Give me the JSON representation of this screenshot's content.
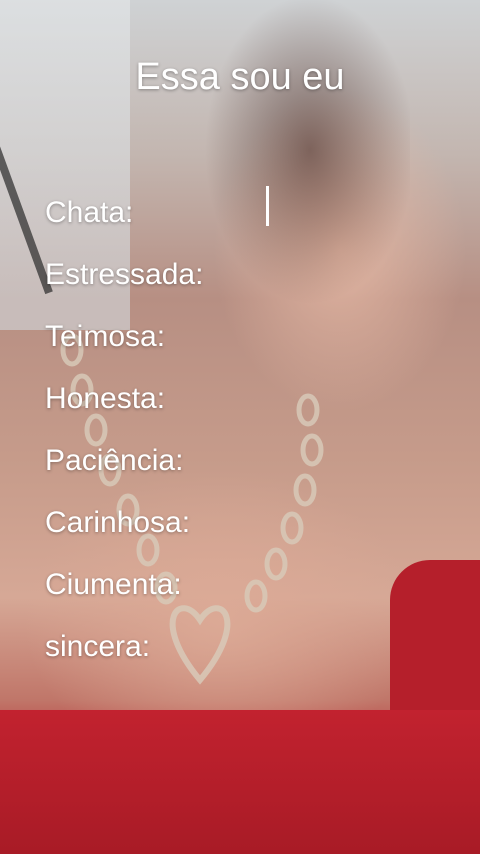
{
  "title": "Essa sou eu",
  "traits": [
    {
      "label": "Chata:"
    },
    {
      "label": "Estressada:"
    },
    {
      "label": "Teimosa:"
    },
    {
      "label": "Honesta:"
    },
    {
      "label": "Paciência:"
    },
    {
      "label": "Carinhosa:"
    },
    {
      "label": "Ciumenta:"
    },
    {
      "label": "sincera:"
    }
  ],
  "colors": {
    "text": "#ffffff",
    "dress": "#b81f2c"
  }
}
